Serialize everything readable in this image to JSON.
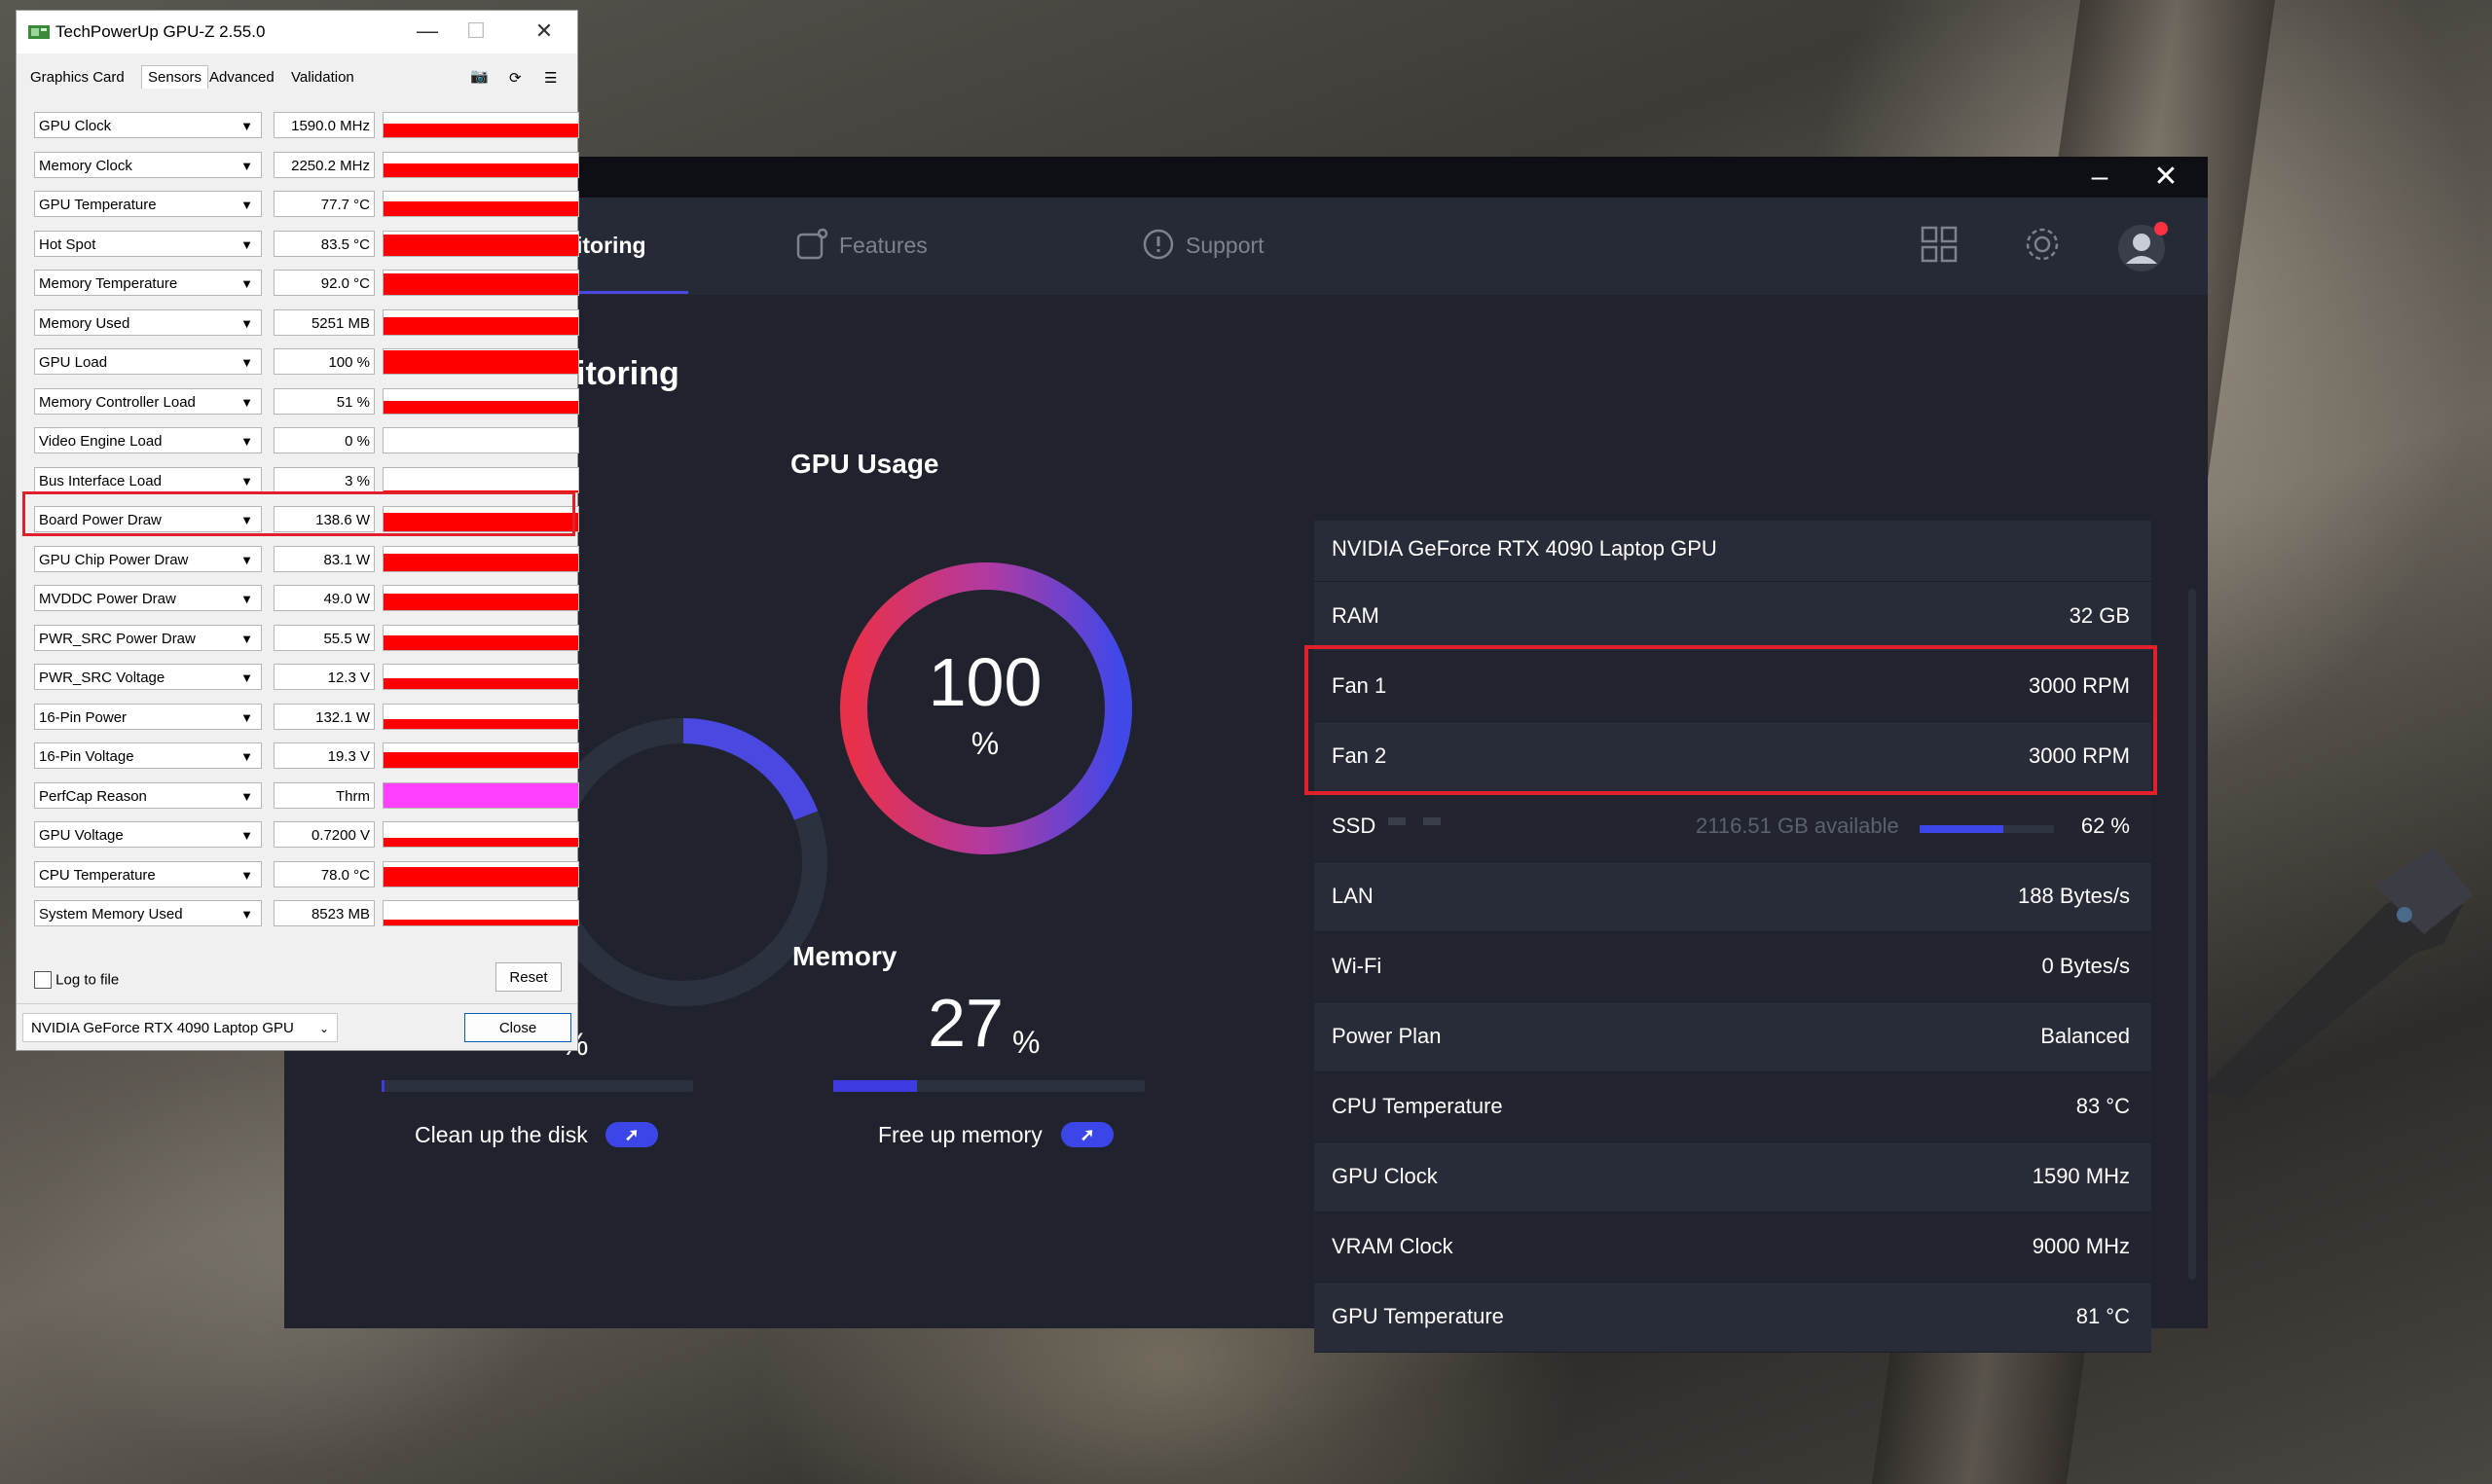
{
  "msi": {
    "tabs": [
      {
        "label": "itoring",
        "icon": "monitor-icon"
      },
      {
        "label": "Features",
        "icon": "features-icon"
      },
      {
        "label": "Support",
        "icon": "support-icon"
      }
    ],
    "section_title": "itoring",
    "gpu_usage": {
      "title": "GPU Usage",
      "value": "100",
      "unit": "%",
      "level": 1.0
    },
    "disk": {
      "unit": "%",
      "action": "Clean up the disk",
      "level": 0.01
    },
    "memory": {
      "title": "Memory",
      "value": "27",
      "unit": "%",
      "action": "Free up memory",
      "level": 0.27
    },
    "info": {
      "gpu_name": "NVIDIA GeForce RTX 4090 Laptop GPU",
      "rows": [
        {
          "label": "RAM",
          "value": "32 GB"
        },
        {
          "label": "Fan 1",
          "value": "3000 RPM"
        },
        {
          "label": "Fan 2",
          "value": "3000 RPM"
        },
        {
          "label": "SSD",
          "value": "62 %",
          "extra": "2116.51 GB available",
          "level": 0.62
        },
        {
          "label": "LAN",
          "value": "188 Bytes/s"
        },
        {
          "label": "Wi-Fi",
          "value": "0 Bytes/s"
        },
        {
          "label": "Power Plan",
          "value": "Balanced"
        },
        {
          "label": "CPU Temperature",
          "value": "83 °C"
        },
        {
          "label": "GPU Clock",
          "value": "1590 MHz"
        },
        {
          "label": "VRAM Clock",
          "value": "9000 MHz"
        },
        {
          "label": "GPU Temperature",
          "value": "81 °C"
        }
      ]
    },
    "colors": {
      "accent": "#3c46e8",
      "highlight": "#e0202a",
      "bg": "#20232e"
    }
  },
  "gpuz": {
    "title": "TechPowerUp GPU-Z 2.55.0",
    "tabs": [
      "Graphics Card",
      "Sensors",
      "Advanced",
      "Validation"
    ],
    "sensors": [
      {
        "name": "GPU Clock",
        "value": "1590.0 MHz",
        "color": "#ff0000",
        "level": 0.55
      },
      {
        "name": "Memory Clock",
        "value": "2250.2 MHz",
        "color": "#ff0000",
        "level": 0.55
      },
      {
        "name": "GPU Temperature",
        "value": "77.7 °C",
        "color": "#ff0000",
        "level": 0.6
      },
      {
        "name": "Hot Spot",
        "value": "83.5 °C",
        "color": "#ff0000",
        "level": 0.85
      },
      {
        "name": "Memory Temperature",
        "value": "92.0 °C",
        "color": "#ff0000",
        "level": 0.9
      },
      {
        "name": "Memory Used",
        "value": "5251 MB",
        "color": "#ff0000",
        "level": 0.7
      },
      {
        "name": "GPU Load",
        "value": "100 %",
        "color": "#ff0000",
        "level": 0.95
      },
      {
        "name": "Memory Controller Load",
        "value": "51 %",
        "color": "#ff0000",
        "level": 0.5
      },
      {
        "name": "Video Engine Load",
        "value": "0 %",
        "color": "#ff0000",
        "level": 0.0
      },
      {
        "name": "Bus Interface Load",
        "value": "3 %",
        "color": "#ff0000",
        "level": 0.08
      },
      {
        "name": "Board Power Draw",
        "value": "138.6 W",
        "color": "#ff0000",
        "level": 0.75
      },
      {
        "name": "GPU Chip Power Draw",
        "value": "83.1 W",
        "color": "#ff0000",
        "level": 0.7
      },
      {
        "name": "MVDDC Power Draw",
        "value": "49.0 W",
        "color": "#ff0000",
        "level": 0.7
      },
      {
        "name": "PWR_SRC Power Draw",
        "value": "55.5 W",
        "color": "#ff0000",
        "level": 0.6
      },
      {
        "name": "PWR_SRC Voltage",
        "value": "12.3 V",
        "color": "#ff0000",
        "level": 0.45
      },
      {
        "name": "16-Pin Power",
        "value": "132.1 W",
        "color": "#ff0000",
        "level": 0.4
      },
      {
        "name": "16-Pin Voltage",
        "value": "19.3 V",
        "color": "#ff0000",
        "level": 0.65
      },
      {
        "name": "PerfCap Reason",
        "value": "Thrm",
        "color": "#ff40ff",
        "level": 1.0
      },
      {
        "name": "GPU Voltage",
        "value": "0.7200 V",
        "color": "#ff0000",
        "level": 0.35
      },
      {
        "name": "CPU Temperature",
        "value": "78.0 °C",
        "color": "#ff0000",
        "level": 0.8
      },
      {
        "name": "System Memory Used",
        "value": "8523 MB",
        "color": "#ff0000",
        "level": 0.25
      }
    ],
    "log_label": "Log to file",
    "reset_label": "Reset",
    "gpu_select": "NVIDIA GeForce RTX 4090 Laptop GPU",
    "close_label": "Close"
  }
}
